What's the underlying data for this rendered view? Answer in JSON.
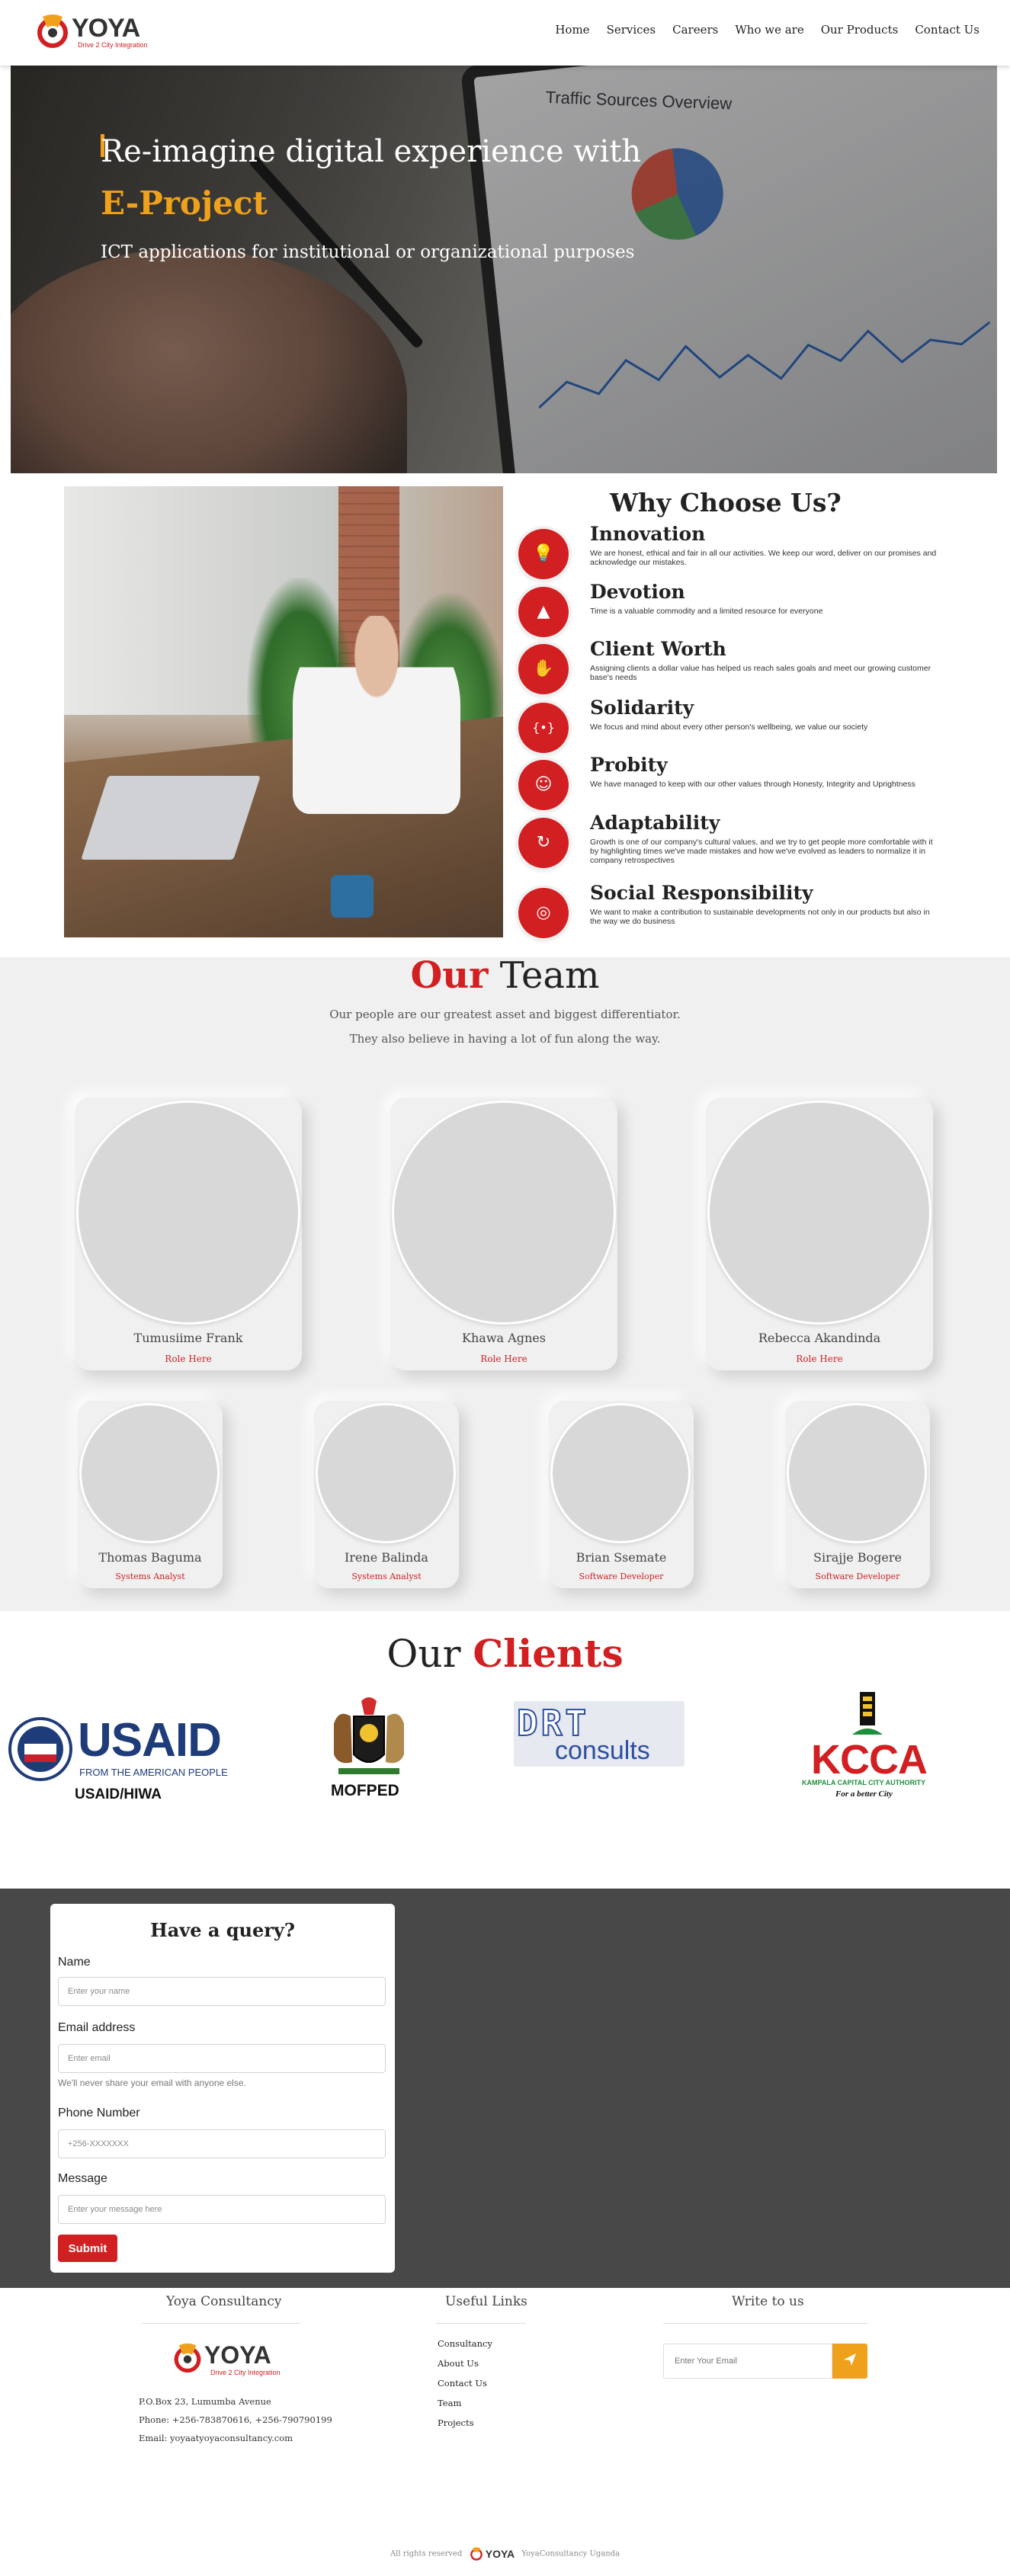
{
  "brand": {
    "name": "YOYA",
    "tagline": "Drive 2 City Integration",
    "accent_red": "#d11f22",
    "accent_orange": "#f0a11c"
  },
  "nav": {
    "items": [
      {
        "label": "Home"
      },
      {
        "label": "Services"
      },
      {
        "label": "Careers"
      },
      {
        "label": "Who we are"
      },
      {
        "label": "Our Products"
      },
      {
        "label": "Contact Us"
      }
    ]
  },
  "hero": {
    "title": "Re-imagine digital experience with",
    "highlight": "E-Project",
    "subtitle": "ICT applications for institutional or organizational purposes",
    "screen_title": "Traffic Sources Overview"
  },
  "why": {
    "title": "Why Choose Us?",
    "items": [
      {
        "icon": "lightbulb-icon",
        "glyph": "💡",
        "title": "Innovation",
        "text": "We are honest, ethical and fair in all our activities. We keep our word, deliver on our promises and acknowledge our mistakes."
      },
      {
        "icon": "road-icon",
        "glyph": "▲",
        "title": "Devotion",
        "text": "Time is a valuable commodity and a limited resource for everyone"
      },
      {
        "icon": "handshake-icon",
        "glyph": "✋",
        "title": "Client Worth",
        "text": "Assigning clients a dollar value has helped us reach sales goals and meet our growing customer base's needs"
      },
      {
        "icon": "brackets-icon",
        "glyph": "{•}",
        "title": "Solidarity",
        "text": "We focus and mind about every other person's wellbeing, we value our society"
      },
      {
        "icon": "users-icon",
        "glyph": "☺",
        "title": "Probity",
        "text": "We have managed to keep with our other values through Honesty, Integrity and Uprightness"
      },
      {
        "icon": "refresh-icon",
        "glyph": "↻",
        "title": "Adaptability",
        "text": "Growth is one of our company's cultural values, and we try to get people more comfortable with it by highlighting times we've made mistakes and how we've evolved as leaders to normalize it in company retrospectives"
      },
      {
        "icon": "globe-icon",
        "glyph": "◎",
        "title": "Social Responsibility",
        "text": "We want to make a contribution to sustainable developments not only in our products but also in the way we do business"
      }
    ]
  },
  "team": {
    "title_highlight": "Our",
    "title_rest": "Team",
    "subtitle_1": "Our people are our greatest asset and biggest differentiator.",
    "subtitle_2": "They also believe in having a lot of fun along the way.",
    "members": [
      {
        "name": "Tumusiime Frank",
        "role": "Role Here"
      },
      {
        "name": "Khawa Agnes",
        "role": "Role Here"
      },
      {
        "name": "Rebecca Akandinda",
        "role": "Role Here"
      },
      {
        "name": "Thomas Baguma",
        "role": "Systems Analyst"
      },
      {
        "name": "Irene Balinda",
        "role": "Systems Analyst"
      },
      {
        "name": "Brian Ssemate",
        "role": "Software Developer"
      },
      {
        "name": "Sirajje Bogere",
        "role": "Software Developer"
      }
    ]
  },
  "clients": {
    "title_rest": "Our",
    "title_highlight": "Clients",
    "usaid": {
      "name": "USAID",
      "line": "FROM THE AMERICAN PEOPLE",
      "caption": "USAID/HIWA"
    },
    "mofped": {
      "caption": "MOFPED"
    },
    "drt": {
      "mark": "DRT",
      "word": "consults"
    },
    "kcca": {
      "name": "KCCA",
      "line": "KAMPALA CAPITAL CITY AUTHORITY",
      "motto": "For a better City"
    }
  },
  "query": {
    "title": "Have a query?",
    "name_label": "Name",
    "name_placeholder": "Enter your name",
    "email_label": "Email address",
    "email_placeholder": "Enter email",
    "email_help": "We'll never share your email with anyone else.",
    "phone_label": "Phone Number",
    "phone_placeholder": "+256-XXXXXXX",
    "message_label": "Message",
    "message_placeholder": "Enter your message here",
    "submit_label": "Submit"
  },
  "footer": {
    "col1_title": "Yoya Consultancy",
    "address": "P.O.Box 23, Lumumba Avenue",
    "phone": "Phone: +256-783870616, +256-790790199",
    "email": "Email: yoyaatyoyaconsultancy.com",
    "col2_title": "Useful Links",
    "links": [
      {
        "label": "Consultancy"
      },
      {
        "label": "About Us"
      },
      {
        "label": "Contact Us"
      },
      {
        "label": "Team"
      },
      {
        "label": "Projects"
      }
    ],
    "col3_title": "Write to us",
    "email_placeholder": "Enter Your Email",
    "copyright_left": "All rights reserved",
    "copyright_right": "YoyaConsultancy Uganda"
  }
}
